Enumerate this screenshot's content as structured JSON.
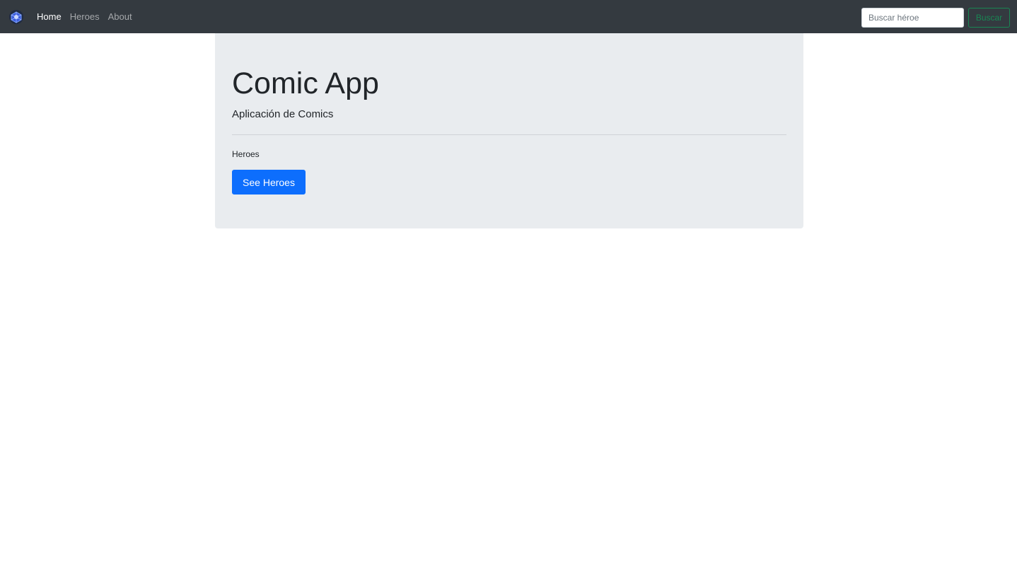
{
  "navbar": {
    "brand_icon": "comic-logo-icon",
    "links": [
      {
        "label": "Home",
        "active": true
      },
      {
        "label": "Heroes",
        "active": false
      },
      {
        "label": "About",
        "active": false
      }
    ],
    "search": {
      "placeholder": "Buscar héroe",
      "value": "",
      "button_label": "Buscar"
    }
  },
  "jumbotron": {
    "title": "Comic App",
    "lead": "Aplicación de Comics",
    "section_label": "Heroes",
    "button_label": "See Heroes"
  },
  "colors": {
    "navbar_bg": "#343a40",
    "jumbotron_bg": "#e9ecef",
    "primary": "#0d6efd",
    "success": "#198754"
  }
}
